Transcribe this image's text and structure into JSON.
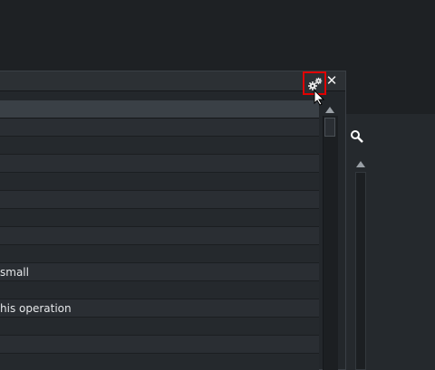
{
  "background_panel": {
    "search_icon": "search-icon"
  },
  "dialog": {
    "title_icons": {
      "settings": "gear-icon",
      "close": "close-icon",
      "close_glyph": "✕"
    },
    "rows": [
      {
        "text": ""
      },
      {
        "text": ""
      },
      {
        "text": ""
      },
      {
        "text": ""
      },
      {
        "text": ""
      },
      {
        "text": ""
      },
      {
        "text": ""
      },
      {
        "text": ""
      },
      {
        "text": ""
      },
      {
        "text": "small"
      },
      {
        "text": ""
      },
      {
        "text": "his operation"
      },
      {
        "text": ""
      },
      {
        "text": ""
      },
      {
        "text": ""
      }
    ]
  },
  "colors": {
    "highlight": "#e00000",
    "panel": "#23272b",
    "header_row": "#3a4046"
  }
}
